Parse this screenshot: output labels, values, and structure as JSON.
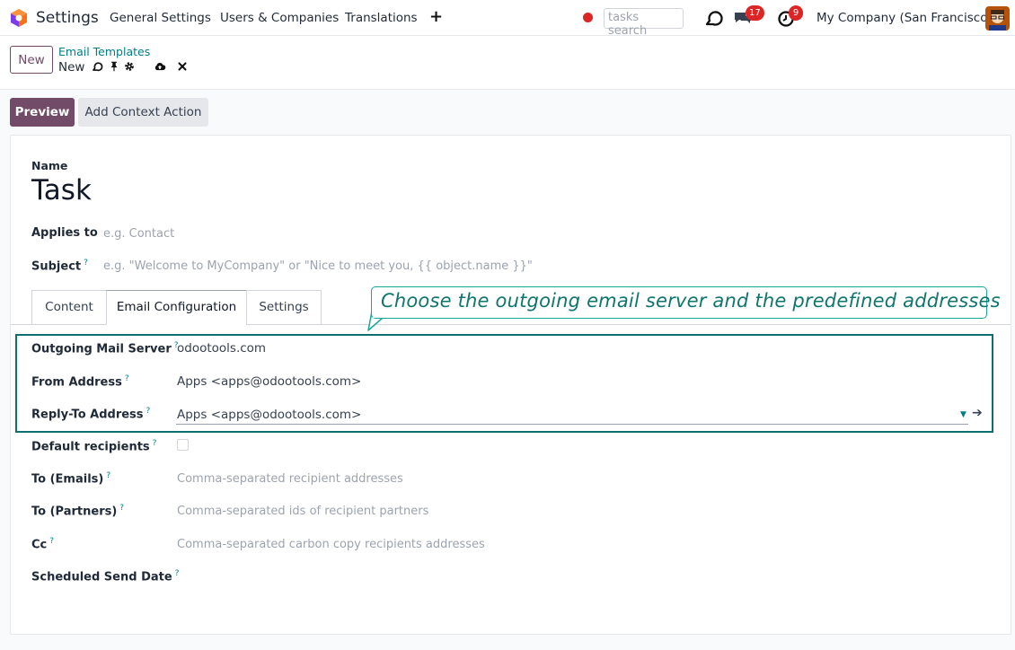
{
  "topnav": {
    "app_name": "Settings",
    "menu": [
      "General Settings",
      "Users & Companies",
      "Translations"
    ],
    "plus": "+",
    "search_placeholder": "tasks search",
    "messages_count": "17",
    "activities_count": "9",
    "company": "My Company (San Francisco)"
  },
  "control": {
    "new_label": "New",
    "breadcrumb_parent": "Email Templates",
    "breadcrumb_current": "New"
  },
  "actions": {
    "preview": "Preview",
    "add_context_action": "Add Context Action"
  },
  "form": {
    "name_label": "Name",
    "name_value": "Task",
    "applies_to_label": "Applies to",
    "applies_to_placeholder": "e.g. Contact",
    "subject_label": "Subject",
    "subject_placeholder": "e.g. \"Welcome to MyCompany\" or \"Nice to meet you, {{ object.name }}\"",
    "help_mark": "?"
  },
  "tabs": [
    "Content",
    "Email Configuration",
    "Settings"
  ],
  "callout": "Choose the outgoing email server and the predefined addresses",
  "fields": {
    "outgoing_label": "Outgoing Mail Server",
    "outgoing_value": "odootools.com",
    "from_label": "From Address",
    "from_value": "Apps <apps@odootools.com>",
    "reply_label": "Reply-To Address",
    "reply_value": "Apps <apps@odootools.com>",
    "default_recipients_label": "Default recipients",
    "to_emails_label": "To (Emails)",
    "to_emails_placeholder": "Comma-separated recipient addresses",
    "to_partners_label": "To (Partners)",
    "to_partners_placeholder": "Comma-separated ids of recipient partners",
    "cc_label": "Cc",
    "cc_placeholder": "Comma-separated carbon copy recipients addresses",
    "scheduled_label": "Scheduled Send Date"
  },
  "colors": {
    "brand": "#714b67",
    "link": "#017e84",
    "callout": "#17a89a",
    "badge": "#dc2626"
  },
  "icons": [
    "odoo-logo-icon",
    "record-dot-icon",
    "discuss-icon",
    "chat-icon",
    "clock-icon",
    "gear-icon",
    "pin-icon",
    "cloud-upload-icon",
    "close-icon",
    "arrow-right-icon",
    "caret-down-icon"
  ]
}
